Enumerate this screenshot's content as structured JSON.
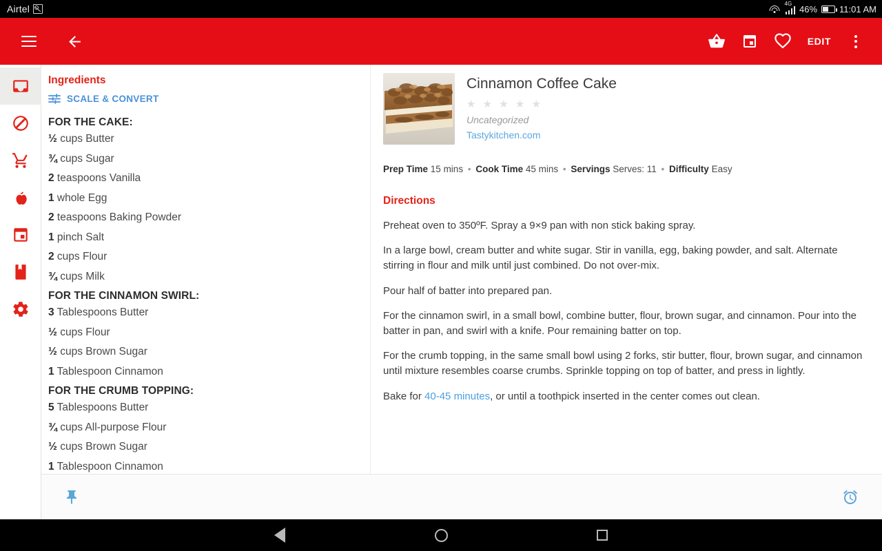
{
  "status_bar": {
    "carrier": "Airtel",
    "sim_icon": "sim-card-icon",
    "wifi_icon": "wifi-icon",
    "network_type": "4G",
    "signal_icon": "signal-bars-icon",
    "battery_percent": "46%",
    "battery_icon": "battery-icon",
    "clock": "11:01 AM"
  },
  "app_bar": {
    "menu_icon": "hamburger-menu-icon",
    "back_icon": "back-arrow-icon",
    "basket_icon": "shopping-basket-icon",
    "calendar_icon": "calendar-icon",
    "favorite_icon": "heart-icon",
    "edit_label": "EDIT",
    "overflow_icon": "more-vert-icon",
    "background_color": "#e60e16"
  },
  "sidebar": {
    "items": [
      {
        "name": "recipes",
        "icon": "recipe-box-icon",
        "active": true
      },
      {
        "name": "no-food",
        "icon": "no-food-icon",
        "active": false
      },
      {
        "name": "shopping-list",
        "icon": "shopping-cart-icon",
        "active": false
      },
      {
        "name": "nutrition",
        "icon": "apple-icon",
        "active": false
      },
      {
        "name": "meal-plan",
        "icon": "calendar-icon",
        "active": false
      },
      {
        "name": "cookbooks",
        "icon": "book-icon",
        "active": false
      },
      {
        "name": "settings",
        "icon": "gear-icon",
        "active": false
      }
    ]
  },
  "ingredients_pane": {
    "title": "Ingredients",
    "scale_convert_label": "SCALE & CONVERT",
    "scale_convert_icon": "tune-sliders-icon",
    "groups": [
      {
        "heading": "FOR THE CAKE:",
        "items": [
          {
            "qty": "½",
            "text": "cups Butter"
          },
          {
            "qty": "¾",
            "text": "cups Sugar"
          },
          {
            "qty": "2",
            "text": "teaspoons Vanilla"
          },
          {
            "qty": "1",
            "text": "whole Egg"
          },
          {
            "qty": "2",
            "text": "teaspoons Baking Powder"
          },
          {
            "qty": "1",
            "text": "pinch Salt"
          },
          {
            "qty": "2",
            "text": "cups Flour"
          },
          {
            "qty": "¾",
            "text": "cups Milk"
          }
        ]
      },
      {
        "heading": "FOR THE CINNAMON SWIRL:",
        "items": [
          {
            "qty": "3",
            "text": "Tablespoons Butter"
          },
          {
            "qty": "½",
            "text": "cups Flour"
          },
          {
            "qty": "½",
            "text": "cups Brown Sugar"
          },
          {
            "qty": "1",
            "text": "Tablespoon Cinnamon"
          }
        ]
      },
      {
        "heading": "FOR THE CRUMB TOPPING:",
        "items": [
          {
            "qty": "5",
            "text": "Tablespoons Butter"
          },
          {
            "qty": "¾",
            "text": "cups All-purpose Flour"
          },
          {
            "qty": "½",
            "text": "cups Brown Sugar"
          },
          {
            "qty": "1",
            "text": "Tablespoon Cinnamon"
          }
        ]
      }
    ]
  },
  "recipe": {
    "thumbnail_icon": "coffee-cake-photo",
    "title": "Cinnamon Coffee Cake",
    "rating_stars": "★ ★ ★ ★ ★",
    "rating_value": "0",
    "category": "Uncategorized",
    "source": "Tastykitchen.com",
    "meta": {
      "prep_time_label": "Prep Time",
      "prep_time_value": "15 mins",
      "cook_time_label": "Cook Time",
      "cook_time_value": "45 mins",
      "servings_label": "Servings",
      "servings_value": "Serves: 11",
      "difficulty_label": "Difficulty",
      "difficulty_value": "Easy",
      "separator": "•"
    },
    "directions_title": "Directions",
    "directions": [
      {
        "text": "Preheat oven to 350ºF. Spray a 9×9 pan with non stick baking spray."
      },
      {
        "text": "In a large bowl, cream butter and white sugar. Stir in vanilla, egg, baking powder, and salt. Alternate stirring in flour and milk until just combined. Do not over-mix."
      },
      {
        "text": "Pour half of batter into prepared pan."
      },
      {
        "text": "For the cinnamon swirl, in a small bowl, combine butter, flour, brown sugar, and cinnamon. Pour into the batter in pan, and swirl with a knife. Pour remaining batter on top."
      },
      {
        "text": "For the crumb topping, in the same small bowl using 2 forks, stir butter, flour, brown sugar, and cinnamon until mixture resembles coarse crumbs. Sprinkle topping on top of batter, and press in lightly."
      },
      {
        "prefix": "Bake for ",
        "link": "40-45 minutes",
        "suffix": ", or until a toothpick inserted in the center comes out clean."
      }
    ]
  },
  "bottom_bar": {
    "pin_icon": "pushpin-icon",
    "timer_icon": "alarm-clock-icon",
    "accent_color": "#5aa7d8"
  },
  "nav_bar": {
    "back_icon": "android-back-icon",
    "home_icon": "android-home-icon",
    "recents_icon": "android-recents-icon"
  }
}
